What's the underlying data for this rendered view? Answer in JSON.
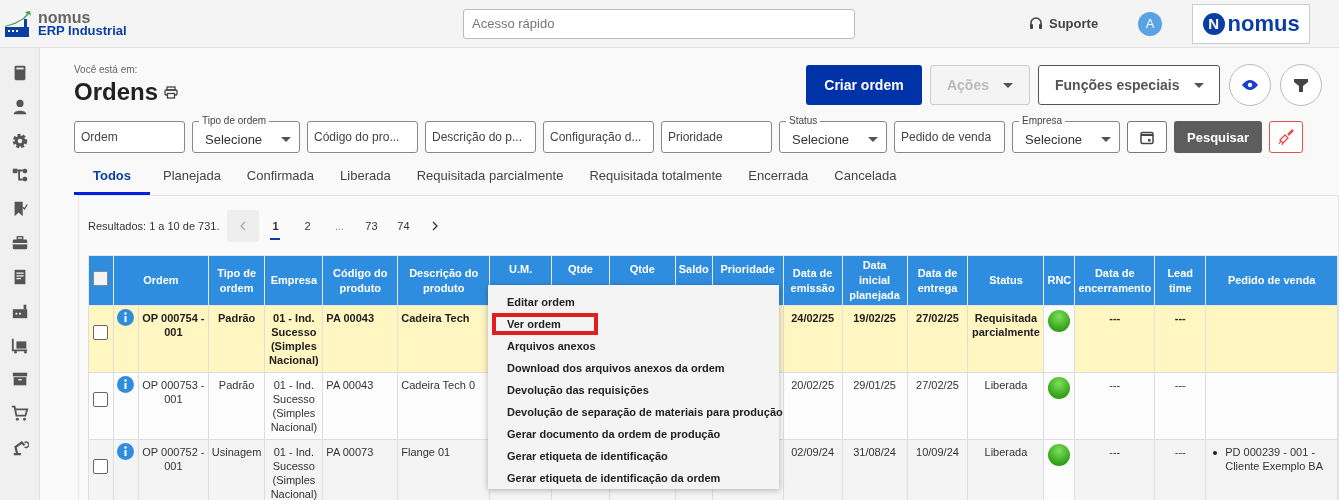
{
  "header": {
    "brand": "nomus",
    "product": "ERP Industrial",
    "search": {
      "placeholder": "Acesso rápido"
    },
    "support": "Suporte",
    "avatar": "A",
    "partner_logo": {
      "letter": "N",
      "name": "nomus"
    }
  },
  "breadcrumb_label": "Você está em:",
  "title": "Ordens",
  "actions": [
    {
      "label": "Criar ordem",
      "kind": "primary",
      "disabled": false
    },
    {
      "label": "Ações",
      "kind": "dropdown",
      "disabled": true
    },
    {
      "label": "Funções especiais",
      "kind": "dropdown",
      "disabled": false
    }
  ],
  "filters": [
    {
      "kind": "input",
      "placeholder": "Ordem"
    },
    {
      "kind": "select",
      "label": "Tipo de ordem",
      "value": "Selecione"
    },
    {
      "kind": "input",
      "placeholder": "Código do pro..."
    },
    {
      "kind": "input",
      "placeholder": "Descrição do p..."
    },
    {
      "kind": "input",
      "placeholder": "Configuração d..."
    },
    {
      "kind": "input",
      "placeholder": "Prioridade"
    },
    {
      "kind": "select",
      "label": "Status",
      "value": "Selecione"
    },
    {
      "kind": "input",
      "placeholder": "Pedido de venda"
    },
    {
      "kind": "select",
      "label": "Empresa",
      "value": "Selecione"
    }
  ],
  "search_button": "Pesquisar",
  "tabs": [
    {
      "label": "Todos",
      "selected": true
    },
    {
      "label": "Planejada",
      "selected": false
    },
    {
      "label": "Confirmada",
      "selected": false
    },
    {
      "label": "Liberada",
      "selected": false
    },
    {
      "label": "Requisitada parcialmente",
      "selected": false
    },
    {
      "label": "Requisitada totalmente",
      "selected": false
    },
    {
      "label": "Encerrada",
      "selected": false
    },
    {
      "label": "Cancelada",
      "selected": false
    }
  ],
  "results": "Resultados: 1 a 10 de 731.",
  "pagination": [
    {
      "kind": "page",
      "label": "1",
      "selected": true
    },
    {
      "kind": "page",
      "label": "2",
      "selected": false
    },
    {
      "kind": "gap",
      "label": "...",
      "selected": false
    },
    {
      "kind": "page",
      "label": "73",
      "selected": false
    },
    {
      "kind": "page",
      "label": "74",
      "selected": false
    }
  ],
  "table": {
    "select_all_checked": false,
    "columns": [
      "Ordem",
      "Tipo de ordem",
      "Empresa",
      "Código do produto",
      "Descrição do produto",
      "U.M.",
      "Qtde",
      "Qtde",
      "Saldo",
      "Prioridade",
      "Data de emissão",
      "Data inicial planejada",
      "Data de entrega",
      "Status",
      "RNC",
      "Data de encerramento",
      "Lead time",
      "Pedido de venda"
    ],
    "rows": [
      {
        "selected": true,
        "checked": false,
        "ordem": "OP 000754 - 001",
        "tipo": "Padrão",
        "empresa": "01 - Ind. Sucesso (Simples Nacional)",
        "codigo": "PA 00043",
        "descricao": "Cadeira Tech",
        "emissao": "24/02/25",
        "inicial": "19/02/25",
        "entrega": "27/02/25",
        "status": "Requisitada parcialmente",
        "encerramento": "---",
        "lead_time": "---"
      },
      {
        "selected": false,
        "checked": false,
        "ordem": "OP 000753 - 001",
        "tipo": "Padrão",
        "empresa": "01 - Ind. Sucesso (Simples Nacional)",
        "codigo": "PA 00043",
        "descricao": "Cadeira Tech 0",
        "emissao": "20/02/25",
        "inicial": "29/01/25",
        "entrega": "27/02/25",
        "status": "Liberada",
        "encerramento": "---",
        "lead_time": "---"
      },
      {
        "selected": false,
        "checked": false,
        "ordem": "OP 000752 - 001",
        "tipo": "Usinagem",
        "empresa": "01 - Ind. Sucesso (Simples Nacional)",
        "codigo": "PA 00073",
        "descricao": "Flange 01",
        "emissao": "02/09/24",
        "inicial": "31/08/24",
        "entrega": "10/09/24",
        "status": "Liberada",
        "encerramento": "---",
        "lead_time": "---",
        "pedidos": [
          "PD 000239 - 001 - Cliente Exemplo BA"
        ]
      }
    ]
  },
  "context_menu": [
    {
      "label": "Editar ordem",
      "highlighted": false
    },
    {
      "label": "Ver ordem",
      "highlighted": true
    },
    {
      "label": "Arquivos anexos",
      "highlighted": false
    },
    {
      "label": "Download dos arquivos anexos da ordem",
      "highlighted": false
    },
    {
      "label": "Devolução das requisições",
      "highlighted": false
    },
    {
      "label": "Devolução de separação de materiais para produção",
      "highlighted": false
    },
    {
      "label": "Gerar documento da ordem de produção",
      "highlighted": false
    },
    {
      "label": "Gerar etiqueta de identificação",
      "highlighted": false
    },
    {
      "label": "Gerar etiqueta de identificação da ordem",
      "highlighted": false
    }
  ]
}
